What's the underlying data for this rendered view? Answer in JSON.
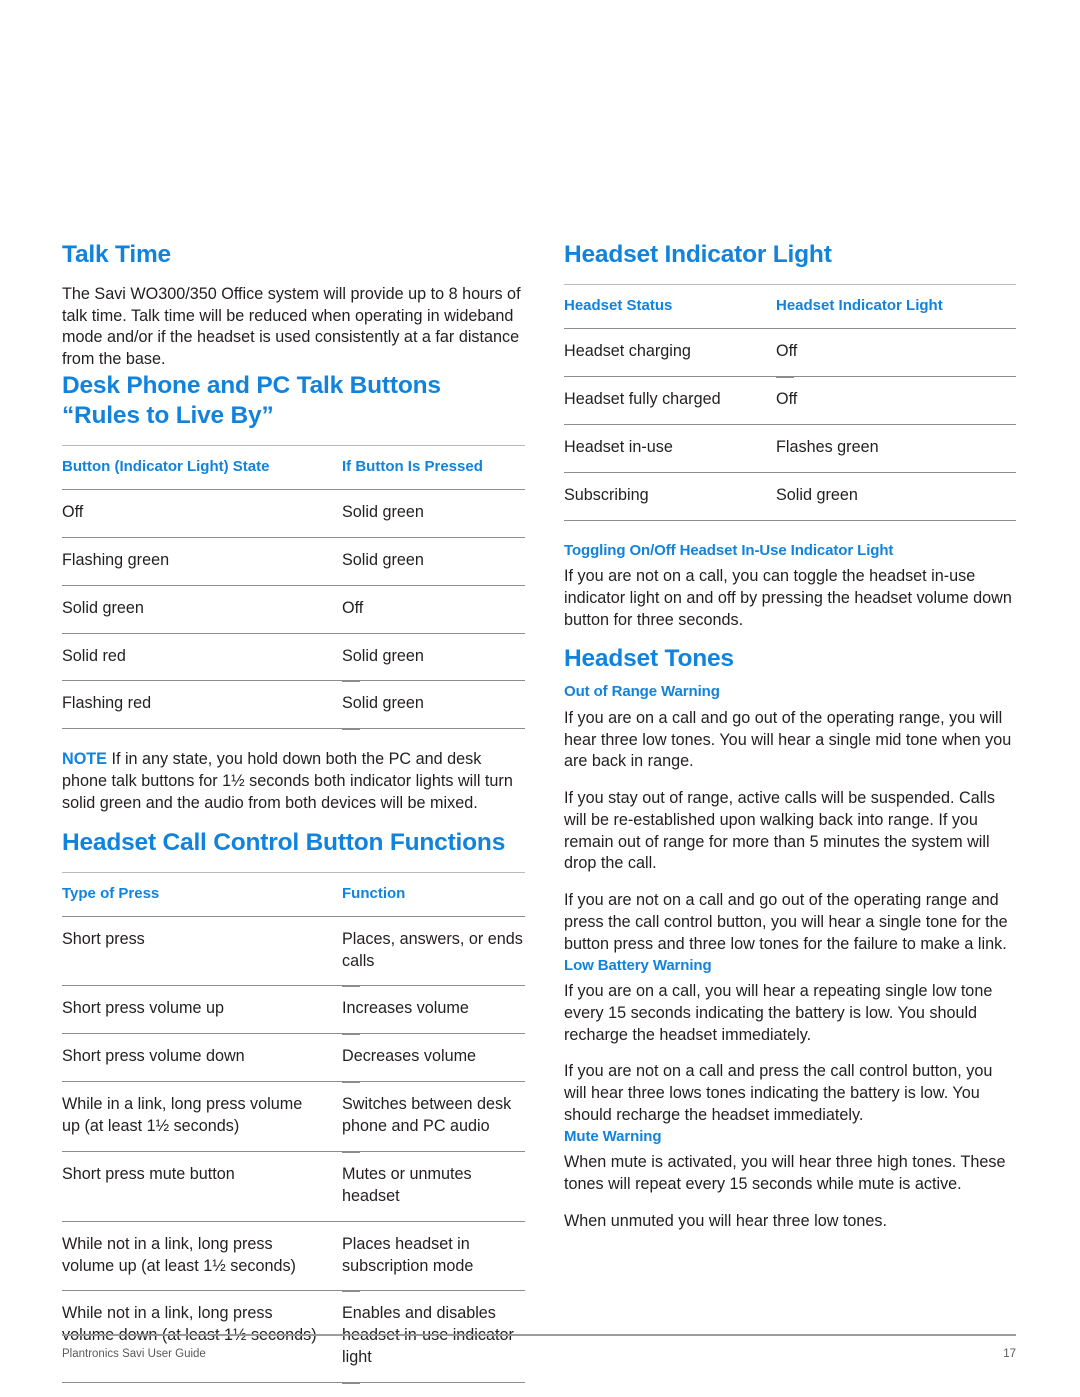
{
  "colors": {
    "heading_blue": "#1283dc",
    "body_text": "#231f20",
    "rule": "#8a8c8e",
    "rule_light": "#b9bbbd"
  },
  "left_column": {
    "talk_time": {
      "heading": "Talk Time",
      "paragraph": "The Savi WO300/350 Office system will provide up to 8 hours of talk time. Talk time will be reduced when operating in wideband mode and/or if the headset is used consistently at a far distance from the base."
    },
    "desk_phone_rules": {
      "heading_line1": "Desk Phone and PC Talk Buttons",
      "heading_line2": "“Rules to Live By”",
      "table": {
        "headers": [
          "Button (Indicator Light) State",
          "If Button Is Pressed"
        ],
        "rows": [
          [
            "Off",
            "Solid green"
          ],
          [
            "Flashing green",
            "Solid green"
          ],
          [
            "Solid green",
            "Off"
          ],
          [
            "Solid red",
            "Solid green"
          ],
          [
            "Flashing red",
            "Solid green"
          ]
        ]
      },
      "note_label": "NOTE",
      "note_text": " If in any state, you hold down both the PC and desk phone talk buttons for 1½ seconds both indicator lights will turn solid green and the audio from both devices will be mixed."
    },
    "headset_call_control": {
      "heading": "Headset Call Control Button Functions",
      "table": {
        "headers": [
          "Type of Press",
          "Function"
        ],
        "rows": [
          [
            "Short press",
            "Places, answers, or ends calls"
          ],
          [
            "Short press volume up",
            "Increases volume"
          ],
          [
            "Short press volume down",
            "Decreases volume"
          ],
          [
            "While in a link, long press volume up (at least 1½ seconds)",
            "Switches between desk phone and PC audio"
          ],
          [
            "Short press mute button",
            "Mutes or unmutes headset"
          ],
          [
            "While not in a link, long press volume up (at least 1½ seconds)",
            "Places headset in subscription mode"
          ],
          [
            "While not in a link, long press volume down (at least 1½ seconds)",
            "Enables and disables headset in-use indicator light"
          ]
        ]
      }
    }
  },
  "right_column": {
    "headset_indicator_light": {
      "heading": "Headset Indicator Light",
      "table": {
        "headers": [
          "Headset Status",
          "Headset Indicator Light"
        ],
        "rows": [
          [
            "Headset charging",
            "Off"
          ],
          [
            "Headset fully charged",
            "Off"
          ],
          [
            "Headset in-use",
            "Flashes green"
          ],
          [
            "Subscribing",
            "Solid green"
          ]
        ]
      }
    },
    "toggling": {
      "heading": "Toggling On/Off Headset In-Use Indicator Light",
      "paragraph": "If you are not on a call, you can toggle the headset in-use indicator light on and off by pressing the headset volume down button for three seconds."
    },
    "headset_tones": {
      "heading": "Headset Tones",
      "out_of_range": {
        "heading": "Out of Range Warning",
        "paragraphs": [
          "If you are on a call and go out of the operating range, you will hear three low tones. You will hear a single mid tone when you are back in range.",
          "If you stay out of range, active calls will be suspended. Calls will be re-established upon walking back into range. If you remain out of range for more than 5 minutes the system will drop the call.",
          "If you are not on a call and go out of the operating range and press the call control button, you will hear a single tone for the button press and three low tones for the failure to make a link."
        ]
      },
      "low_battery": {
        "heading": "Low Battery Warning",
        "paragraphs": [
          "If you are on a call, you will hear a repeating single low tone every 15 seconds indicating the battery is low. You should recharge the headset immediately.",
          "If you are not on a call and press the call control button, you will hear three lows tones indicating the battery is low. You should recharge the headset immediately."
        ]
      },
      "mute": {
        "heading": "Mute Warning",
        "paragraphs": [
          "When mute is activated, you will hear three high tones. These tones will repeat every 15 seconds while mute is active.",
          "When unmuted you will hear three low tones."
        ]
      }
    }
  },
  "footer": {
    "guide_name": "Plantronics Savi User Guide",
    "page_number": "17"
  }
}
